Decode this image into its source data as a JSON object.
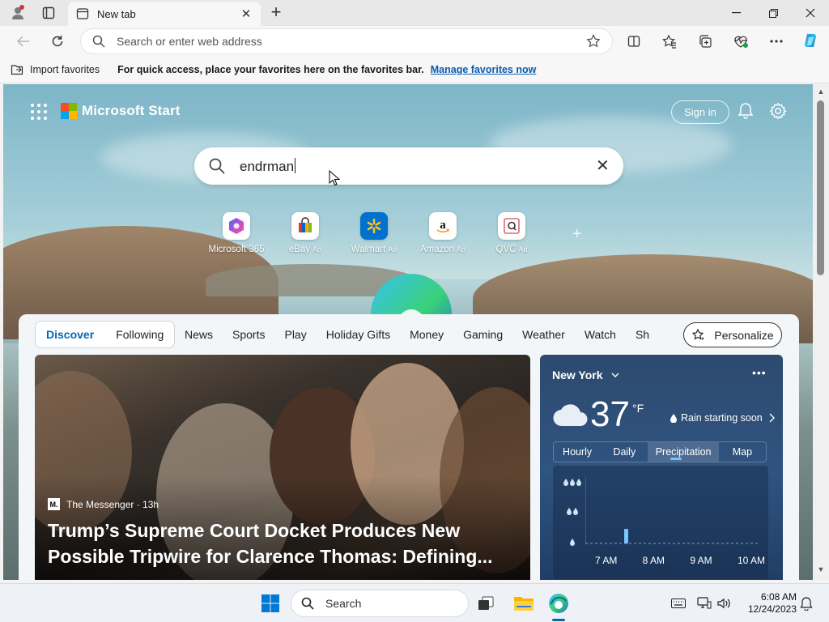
{
  "browser": {
    "tab_title": "New tab",
    "omnibox_placeholder": "Search or enter web address",
    "favorites": {
      "import_label": "Import favorites",
      "hint": "For quick access, place your favorites here on the favorites bar.",
      "manage_link": "Manage favorites now"
    }
  },
  "start": {
    "brand": "Microsoft Start",
    "sign_in": "Sign in",
    "search_value": "endrman",
    "tiles": [
      {
        "label": "Microsoft 365",
        "ad": ""
      },
      {
        "label": "eBay",
        "ad": "Ad"
      },
      {
        "label": "Walmart",
        "ad": "Ad"
      },
      {
        "label": "Amazon",
        "ad": "Ad"
      },
      {
        "label": "QVC",
        "ad": "Ad"
      }
    ]
  },
  "feed": {
    "tabs": [
      "Discover",
      "Following"
    ],
    "categories": [
      "News",
      "Sports",
      "Play",
      "Holiday Gifts",
      "Money",
      "Gaming",
      "Weather",
      "Watch",
      "Sh"
    ],
    "personalize": "Personalize",
    "hero": {
      "badge": "M.",
      "source": "The Messenger · 13h",
      "title": "Trump’s Supreme Court Docket Produces New Possible Tripwire for Clarence Thomas: Defining..."
    }
  },
  "weather": {
    "city": "New York",
    "temp": "37",
    "unit": "°F",
    "note": "Rain starting soon",
    "tabs": [
      "Hourly",
      "Daily",
      "Precipitation",
      "Map"
    ],
    "chart_times": [
      "7 AM",
      "8 AM",
      "9 AM",
      "10 AM"
    ]
  },
  "taskbar": {
    "search": "Search",
    "time": "6:08 AM",
    "date": "12/24/2023"
  }
}
